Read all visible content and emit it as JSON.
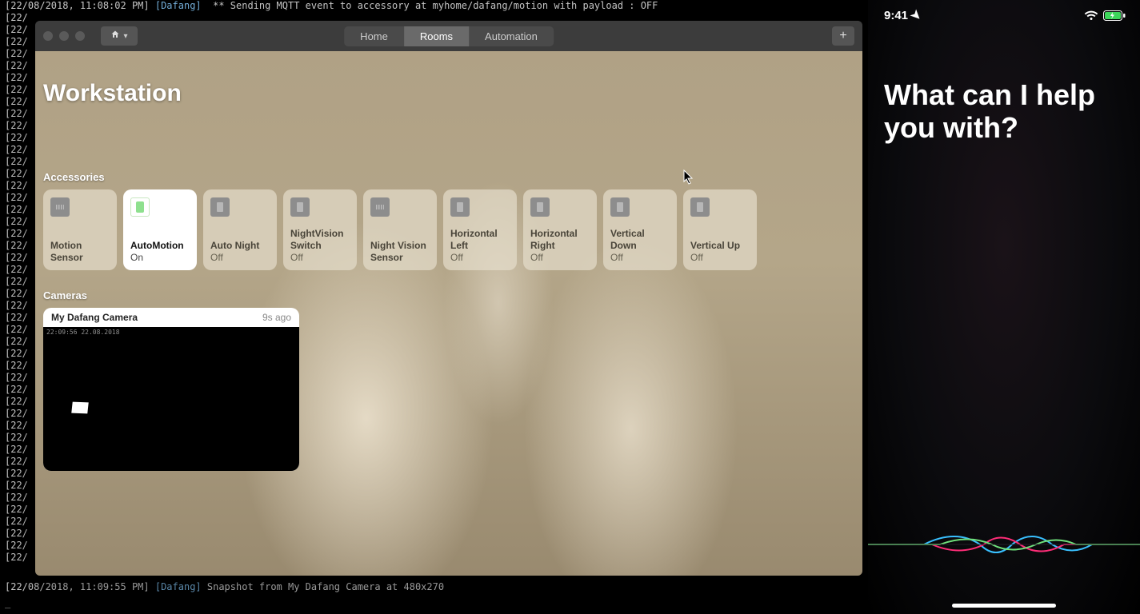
{
  "terminal": {
    "topLine": "[22/08/2018, 11:08:02 PM] [Dafang]  ** Sending MQTT event to accessory at myhome/dafang/motion with payload : OFF",
    "bgPrefix": "[22/",
    "bgRows": 46,
    "bottomLine1": "[22/08/2018, 11:09:55 PM] ",
    "bottomTag": "[Dafang]",
    "bottomLine2": " Snapshot from My Dafang Camera at 480x270"
  },
  "home": {
    "nav": {
      "home": "Home",
      "rooms": "Rooms",
      "automation": "Automation"
    },
    "roomTitle": "Workstation",
    "sections": {
      "accessories": "Accessories",
      "cameras": "Cameras"
    },
    "accessories": [
      {
        "name": "Motion Sensor",
        "state": "",
        "on": false,
        "iconClass": "sensor"
      },
      {
        "name": "AutoMotion",
        "state": "On",
        "on": true,
        "iconClass": "switch-on"
      },
      {
        "name": "Auto Night",
        "state": "Off",
        "on": false,
        "iconClass": "generic"
      },
      {
        "name": "NightVision Switch",
        "state": "Off",
        "on": false,
        "iconClass": "generic"
      },
      {
        "name": "Night Vision Sensor",
        "state": "",
        "on": false,
        "iconClass": "sensor"
      },
      {
        "name": "Horizontal Left",
        "state": "Off",
        "on": false,
        "iconClass": "generic"
      },
      {
        "name": "Horizontal Right",
        "state": "Off",
        "on": false,
        "iconClass": "generic"
      },
      {
        "name": "Vertical Down",
        "state": "Off",
        "on": false,
        "iconClass": "generic"
      },
      {
        "name": "Vertical Up",
        "state": "Off",
        "on": false,
        "iconClass": "generic"
      }
    ],
    "camera": {
      "name": "My Dafang Camera",
      "ago": "9s ago",
      "timestamp": "22:09:56 22.08.2018"
    }
  },
  "phone": {
    "time": "9:41",
    "prompt": "What can I help you with?"
  }
}
